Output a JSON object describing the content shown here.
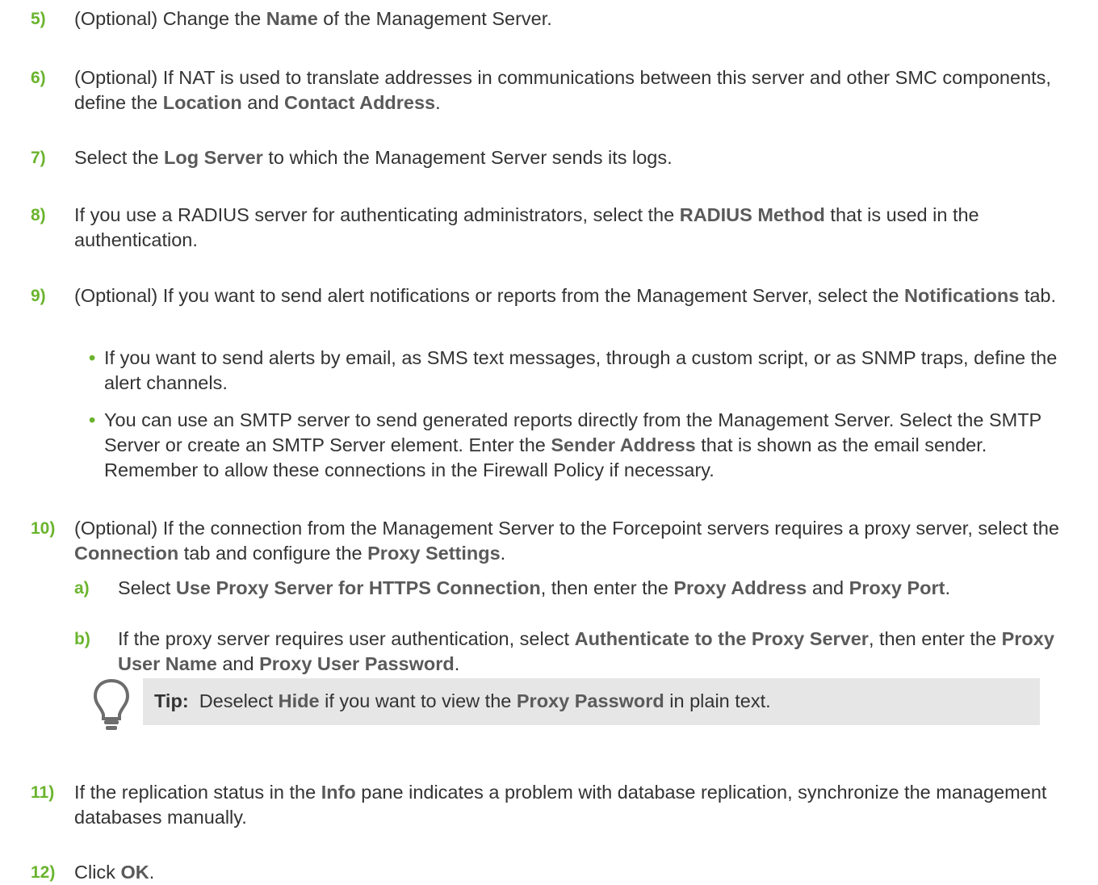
{
  "steps": [
    {
      "number": "5)",
      "parts": [
        "(Optional) Change the ",
        "Name",
        " of the Management Server."
      ]
    },
    {
      "number": "6)",
      "parts": [
        "(Optional) If NAT is used to translate addresses in communications between this server and other SMC components, define the ",
        "Location",
        " and ",
        "Contact Address",
        "."
      ]
    },
    {
      "number": "7)",
      "parts": [
        "Select the ",
        "Log Server",
        " to which the Management Server sends its logs."
      ]
    },
    {
      "number": "8)",
      "parts": [
        "If you use a RADIUS server for authenticating administrators, select the ",
        "RADIUS Method",
        " that is used in the authentication."
      ]
    },
    {
      "number": "9)",
      "parts": [
        "(Optional) If you want to send alert notifications or reports from the Management Server, select the ",
        "Notifications",
        " tab."
      ],
      "bullets": [
        {
          "parts": [
            "If you want to send alerts by email, as SMS text messages, through a custom script, or as SNMP traps, define the alert channels."
          ]
        },
        {
          "parts": [
            "You can use an SMTP server to send generated reports directly from the Management Server. Select the SMTP Server or create an SMTP Server element. Enter the ",
            "Sender Address",
            " that is shown as the email sender. Remember to allow these connections in the Firewall Policy if necessary."
          ]
        }
      ]
    },
    {
      "number": "10)",
      "parts": [
        "(Optional) If the connection from the Management Server to the Forcepoint servers requires a proxy server, select the ",
        "Connection",
        " tab and configure the ",
        "Proxy Settings",
        "."
      ],
      "substeps": [
        {
          "letter": "a)",
          "parts": [
            "Select ",
            "Use Proxy Server for HTTPS Connection",
            ", then enter the ",
            "Proxy Address",
            " and ",
            "Proxy Port",
            "."
          ]
        },
        {
          "letter": "b)",
          "parts": [
            "If the proxy server requires user authentication, select ",
            "Authenticate to the Proxy Server",
            ", then enter the ",
            "Proxy User Name",
            " and ",
            "Proxy User Password",
            "."
          ]
        }
      ],
      "tip": {
        "label": "Tip:",
        "parts": [
          "Deselect ",
          "Hide",
          " if you want to view the ",
          "Proxy Password",
          " in plain text."
        ]
      }
    },
    {
      "number": "11)",
      "parts": [
        "If the replication status in the ",
        "Info",
        " pane indicates a problem with database replication, synchronize the management databases manually."
      ]
    },
    {
      "number": "12)",
      "parts": [
        "Click ",
        "OK",
        "."
      ]
    }
  ],
  "colors": {
    "accent": "#6ab42d",
    "ui_text": "#5a5a5a",
    "tip_bg": "#e6e6e6"
  },
  "icons": {
    "tip": "lightbulb-icon"
  }
}
